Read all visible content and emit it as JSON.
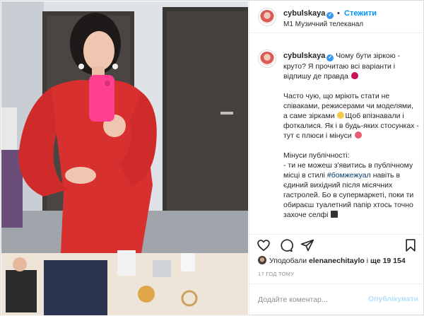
{
  "author": {
    "username": "cybulskaya",
    "verified_icon": "verified-badge-icon",
    "follow_label": "Стежити",
    "separator": "•",
    "location": "М1 Музичний телеканал"
  },
  "caption": {
    "paragraphs": [
      "Чому бути зіркою - круто? Я прочитаю всі варіанти і відпишу де правда",
      "Часто чую, що мріють стати не співаками, режисерами чи моделями, а саме зірками",
      "Щоб впізнавали і фоткалися. Як і в будь-яких стосунках - тут є плюси і мінуси",
      "Мінуси публічності:",
      "- ти не можеш з'явитись в публічному місці в стилі",
      "#бомжежуал",
      "навіть в єдиний вихідний після місячних гастролей. Бо в супермаркеті, поки ти обираєш туалетний папір хтось точно захоче селфі"
    ]
  },
  "actions": {
    "like_icon": "heart-icon",
    "comment_icon": "comment-icon",
    "share_icon": "send-icon",
    "save_icon": "bookmark-icon"
  },
  "likes": {
    "prefix": "Уподобали",
    "user": "elenanechitaylo",
    "middle": "і",
    "count_text": "ще 19 154"
  },
  "timestamp": "17 ГОД ТОМУ",
  "comment": {
    "placeholder": "Додайте коментар...",
    "publish_label": "Опублікувати"
  },
  "colors": {
    "link_blue": "#0095f6",
    "publish_disabled": "#b2dffc",
    "hashtag": "#00376b",
    "dress_red": "#d8302f",
    "phone_pink": "#ff3f8f"
  }
}
